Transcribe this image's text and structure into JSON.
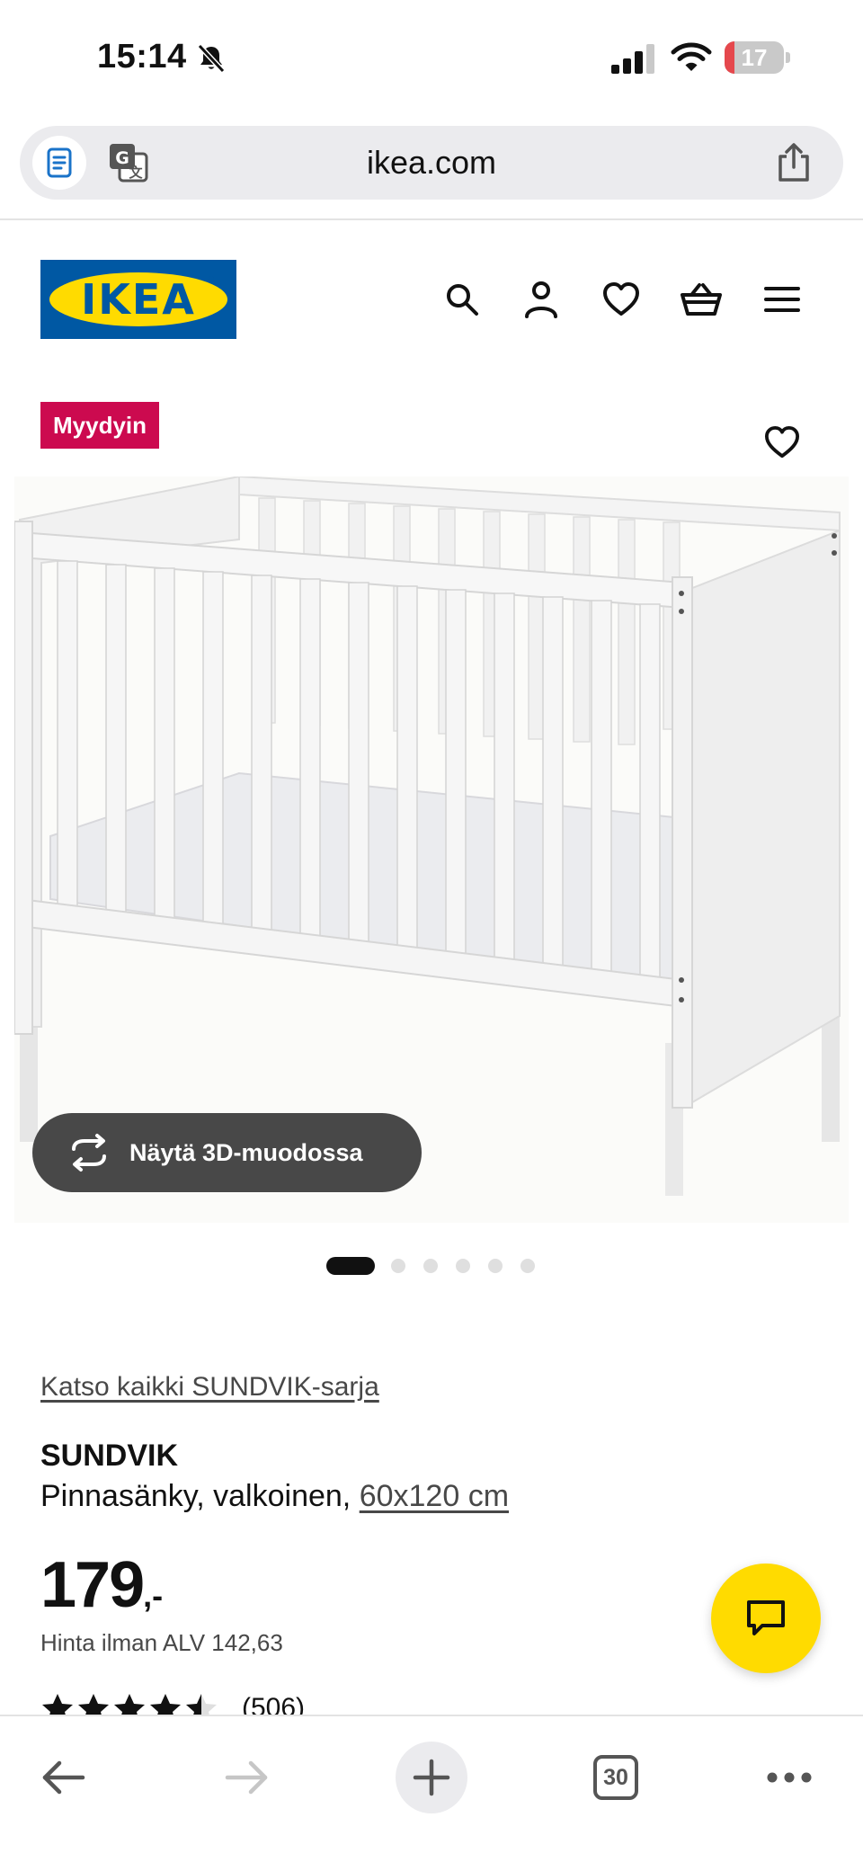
{
  "status_bar": {
    "time": "15:14",
    "silent_icon": "bell-slash-icon",
    "signal_icon": "cellular-signal-icon",
    "wifi_icon": "wifi-icon",
    "battery_level": "17",
    "battery_fraction": 0.17,
    "battery_color": "#e5484d"
  },
  "browser": {
    "url": "ikea.com",
    "reader_icon": "reader-mode-icon",
    "translate_icon": "translate-icon",
    "share_icon": "share-icon"
  },
  "site_header": {
    "logo_text": "IKEA",
    "logo_colors": {
      "blue": "#0058a3",
      "yellow": "#ffdb00"
    },
    "icons": [
      "search-icon",
      "account-icon",
      "wishlist-heart-icon",
      "cart-icon",
      "menu-icon"
    ]
  },
  "product": {
    "badge": "Myydyin",
    "badge_color": "#cc0a4f",
    "view_3d_label": "Näytä 3D-muodossa",
    "image_count": 6,
    "active_image": 1,
    "series_link": "Katso kaikki SUNDVIK-sarja",
    "name": "SUNDVIK",
    "description": "Pinnasänky, valkoinen,",
    "size": "60x120 cm",
    "price_integer": "179",
    "price_suffix": ",-",
    "price_vat": "Hinta ilman ALV 142,63",
    "rating_value": 4.5,
    "review_count": "(506)"
  },
  "chat": {
    "icon": "chat-bubble-icon",
    "color": "#ffdb00"
  },
  "toolbar": {
    "back_icon": "back-arrow-icon",
    "forward_icon": "forward-arrow-icon",
    "new_tab_icon": "plus-icon",
    "tab_count": "30",
    "more_icon": "more-dots-icon"
  }
}
